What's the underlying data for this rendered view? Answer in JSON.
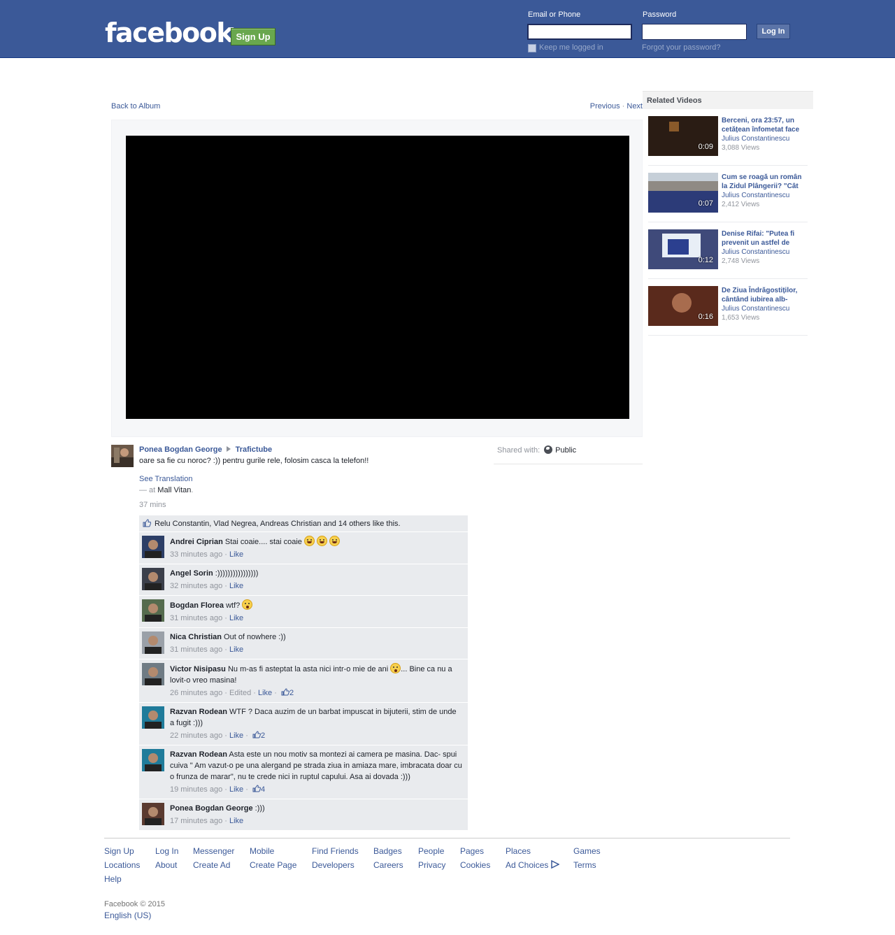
{
  "header": {
    "logo": "facebook",
    "signup_label": "Sign Up",
    "email_label": "Email or Phone",
    "password_label": "Password",
    "login_label": "Log In",
    "keep_logged_in": "Keep me logged in",
    "forgot_password": "Forgot your password?"
  },
  "media": {
    "back_to_album": "Back to Album",
    "previous": "Previous",
    "separator": "·",
    "next": "Next"
  },
  "related": {
    "heading": "Related Videos",
    "items": [
      {
        "title": "Berceni, ora 23:57, un cetățean înfometat face",
        "author": "Julius Constantinescu",
        "views": "3,088 Views",
        "duration": "0:09",
        "thumb_color": "#2a1c14"
      },
      {
        "title": "Cum se roagă un român la Zidul Plângerii? \"Cât",
        "author": "Julius Constantinescu",
        "views": "2,412 Views",
        "duration": "0:07",
        "thumb_color": "#8f8a84"
      },
      {
        "title": "Denise Rifai: \"Putea fi prevenit un astfel de",
        "author": "Julius Constantinescu",
        "views": "2,748 Views",
        "duration": "0:12",
        "thumb_color": "#3f4a7a"
      },
      {
        "title": "De Ziua Îndrăgostiților, cântând iubirea alb-",
        "author": "Julius Constantinescu",
        "views": "1,653 Views",
        "duration": "0:16",
        "thumb_color": "#5a2a1c"
      }
    ]
  },
  "post": {
    "author": "Ponea Bogdan George",
    "target": "Trafictube",
    "text": "oare sa fie cu noroc? :)) pentru gurile rele, folosim casca la telefon!!",
    "see_translation": "See Translation",
    "at_prefix": "— at ",
    "place": "Mall Vitan",
    "place_suffix": ".",
    "time": "37 mins",
    "shared_with_label": "Shared with:",
    "audience": "Public"
  },
  "likes_summary": "Relu Constantin, Vlad Negrea, Andreas Christian and 14 others like this.",
  "comments": [
    {
      "name": "Andrei Ciprian",
      "text": "Stai coaie.... stai coaie",
      "time": "33 minutes ago",
      "edited": "",
      "like": "Like",
      "likes": ""
    },
    {
      "name": "Angel Sorin",
      "text": ":))))))))))))))))",
      "time": "32 minutes ago",
      "edited": "",
      "like": "Like",
      "likes": ""
    },
    {
      "name": "Bogdan Florea",
      "text": "wtf?",
      "time": "31 minutes ago",
      "edited": "",
      "like": "Like",
      "likes": ""
    },
    {
      "name": "Nica Christian",
      "text": "Out of nowhere :))",
      "time": "31 minutes ago",
      "edited": "",
      "like": "Like",
      "likes": ""
    },
    {
      "name": "Victor Nisipasu",
      "text": "Nu m-as fi asteptat la asta nici intr-o mie de ani",
      "text2": "... Bine ca nu a lovit-o vreo masina!",
      "time": "26 minutes ago",
      "edited": "Edited",
      "like": "Like",
      "likes": "2"
    },
    {
      "name": "Razvan Rodean",
      "text": "WTF ? Daca auzim de un barbat impuscat in bijuterii, stim de unde a fugit :)))",
      "time": "22 minutes ago",
      "edited": "",
      "like": "Like",
      "likes": "2"
    },
    {
      "name": "Razvan Rodean",
      "text": "Asta este un nou motiv sa montezi ai camera pe masina. Dac- spui cuiva \" Am vazut-o pe una alergand pe strada ziua in amiaza mare, imbracata doar cu o frunza de marar\", nu te crede nici in ruptul capului. Asa ai dovada :)))",
      "time": "19 minutes ago",
      "edited": "",
      "like": "Like",
      "likes": "4"
    },
    {
      "name": "Ponea Bogdan George",
      "text": ":)))",
      "time": "17 minutes ago",
      "edited": "",
      "like": "Like",
      "likes": ""
    }
  ],
  "footer": {
    "links": [
      "Sign Up",
      "Log In",
      "Messenger",
      "Mobile",
      "Find Friends",
      "Badges",
      "People",
      "Pages",
      "Places",
      "Games",
      "Locations",
      "About",
      "Create Ad",
      "Create Page",
      "Developers",
      "Careers",
      "Privacy",
      "Cookies",
      "Ad Choices",
      "Terms",
      "Help"
    ],
    "copyright": "Facebook © 2015",
    "language": "English (US)"
  },
  "colors": {
    "brand": "#3b5998",
    "signup_green": "#69a74e"
  }
}
